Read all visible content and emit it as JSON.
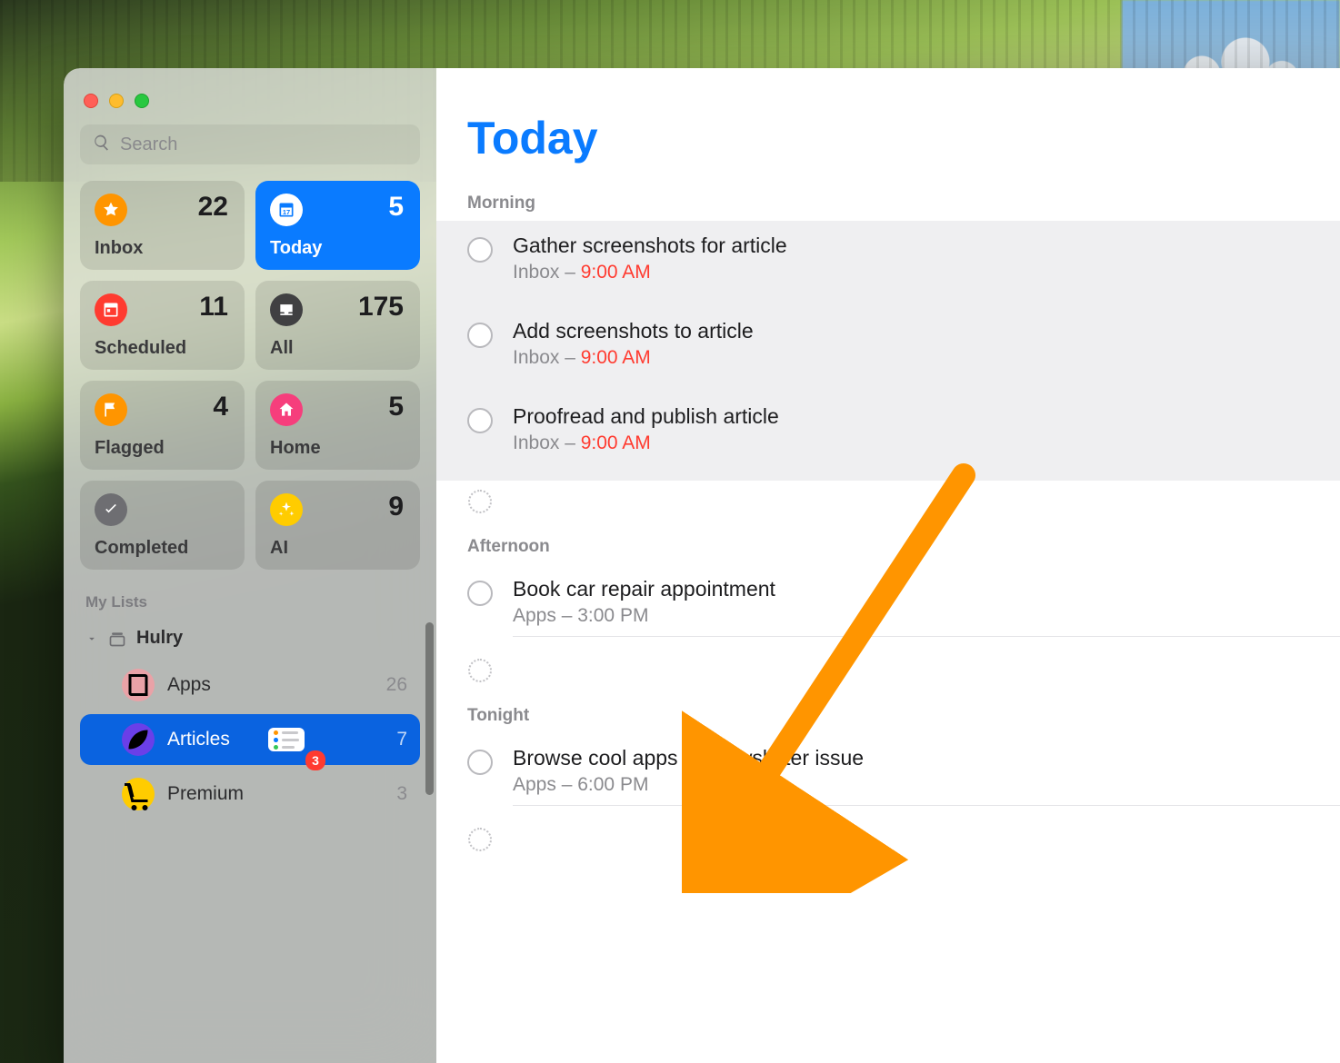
{
  "search": {
    "placeholder": "Search"
  },
  "tiles": [
    {
      "label": "Inbox",
      "count": "22"
    },
    {
      "label": "Today",
      "count": "5"
    },
    {
      "label": "Scheduled",
      "count": "11"
    },
    {
      "label": "All",
      "count": "175"
    },
    {
      "label": "Flagged",
      "count": "4"
    },
    {
      "label": "Home",
      "count": "5"
    },
    {
      "label": "Completed",
      "count": ""
    },
    {
      "label": "AI",
      "count": "9"
    }
  ],
  "mylists_header": "My Lists",
  "group_name": "Hulry",
  "lists": [
    {
      "name": "Apps",
      "count": "26"
    },
    {
      "name": "Articles",
      "count": "7",
      "badge": "3"
    },
    {
      "name": "Premium",
      "count": "3"
    }
  ],
  "main": {
    "title": "Today",
    "sections": {
      "morning": {
        "label": "Morning"
      },
      "afternoon": {
        "label": "Afternoon"
      },
      "tonight": {
        "label": "Tonight"
      }
    },
    "tasks": {
      "m0": {
        "title": "Gather screenshots for article",
        "list": "Inbox",
        "sep": " – ",
        "time": "9:00 AM"
      },
      "m1": {
        "title": "Add screenshots to article",
        "list": "Inbox",
        "sep": " – ",
        "time": "9:00 AM"
      },
      "m2": {
        "title": "Proofread and publish article",
        "list": "Inbox",
        "sep": " – ",
        "time": "9:00 AM"
      },
      "a0": {
        "title": "Book car repair appointment",
        "list": "Apps",
        "sep": " – ",
        "time": "3:00 PM"
      },
      "t0": {
        "title": "Browse cool apps for newsletter issue",
        "list": "Apps",
        "sep": " – ",
        "time": "6:00 PM"
      }
    }
  }
}
